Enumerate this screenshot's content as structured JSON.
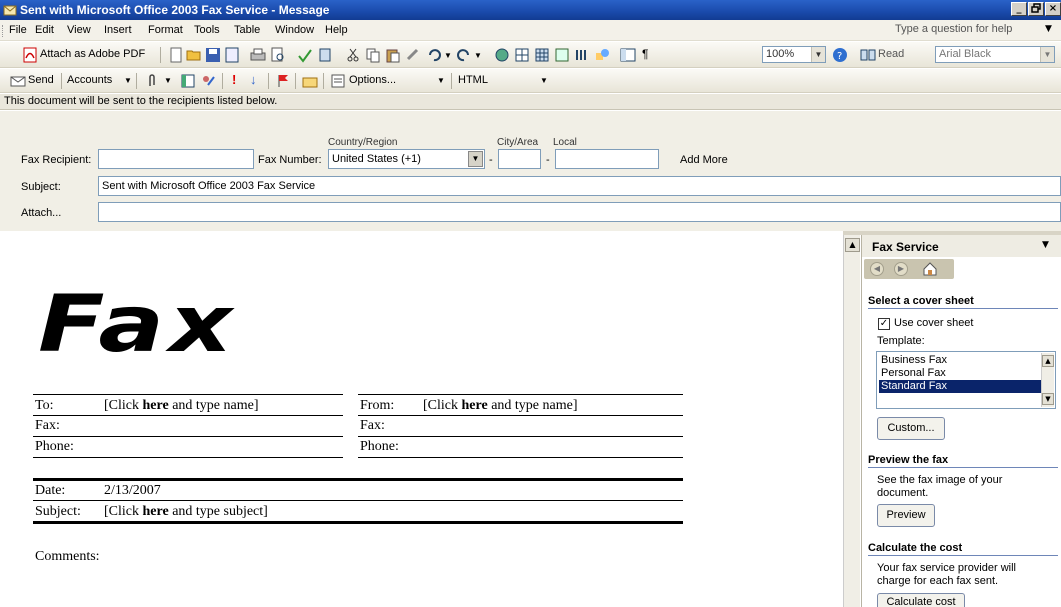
{
  "window": {
    "title": "Sent with Microsoft Office 2003 Fax Service - Message",
    "controls": [
      "_",
      "×"
    ]
  },
  "menubar": {
    "items": [
      "File",
      "Edit",
      "View",
      "Insert",
      "Format",
      "Tools",
      "Table",
      "Window",
      "Help"
    ],
    "help_placeholder": "Type a question for help"
  },
  "toolbar1": {
    "attach_pdf_label": "Attach as Adobe PDF",
    "zoom": "100%",
    "read_label": "Read",
    "font": "Arial Black"
  },
  "toolbar2": {
    "send_label": "Send",
    "accounts_label": "Accounts",
    "options_label": "Options...",
    "format_value": "HTML"
  },
  "infobar": {
    "text": "This document will be sent to the recipients listed below."
  },
  "header": {
    "fax_recipient_label": "Fax Recipient:",
    "fax_recipient_value": "",
    "fax_number_label": "Fax Number:",
    "country_region_caption": "Country/Region",
    "country_value": "United States (+1)",
    "city_area_caption": "City/Area",
    "local_caption": "Local",
    "dash": "-",
    "add_more_label": "Add More",
    "subject_label": "Subject:",
    "subject_value": "Sent with Microsoft Office 2003 Fax Service",
    "attach_label": "Attach..."
  },
  "document": {
    "logo": "Fax",
    "to_label": "To:",
    "to_value_pre": "[Click ",
    "to_value_bold": "here",
    "to_value_post": " and type name]",
    "from_label": "From:",
    "from_value_pre": "[Click ",
    "from_value_bold": "here",
    "from_value_post": " and type name]",
    "fax_label": "Fax:",
    "fax_label_right": "Fax:",
    "phone_label": "Phone:",
    "phone_label_right": "Phone:",
    "date_label": "Date:",
    "date_value": "2/13/2007",
    "subject_label": "Subject:",
    "subject_pre": "[Click ",
    "subject_bold": "here",
    "subject_post": " and type subject]",
    "comments_label": "Comments:"
  },
  "taskpane": {
    "title": "Fax Service",
    "cover_section": "Select a cover sheet",
    "use_cover_label": "Use cover sheet",
    "use_cover_checked": true,
    "template_label": "Template:",
    "templates": [
      "Business Fax",
      "Personal Fax",
      "Standard Fax"
    ],
    "selected_template": "Standard Fax",
    "custom_button": "Custom...",
    "preview_section": "Preview the fax",
    "preview_text_1": "See the fax image of your",
    "preview_text_2": "document.",
    "preview_button": "Preview",
    "cost_section": "Calculate the cost",
    "cost_text_1": "Your fax service provider will",
    "cost_text_2": "charge for each fax sent.",
    "cost_button": "Calculate cost"
  },
  "colors": {
    "titlebar": "#1a4aab",
    "selection": "#0a246a",
    "section_rule": "#6e86b8"
  }
}
